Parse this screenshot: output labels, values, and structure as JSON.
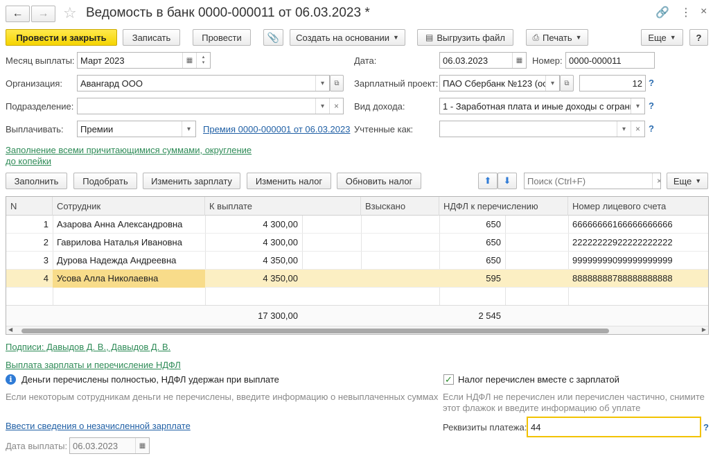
{
  "title": "Ведомость в банк 0000-000011 от 06.03.2023 *",
  "toolbar": {
    "post_close": "Провести и закрыть",
    "save": "Записать",
    "post": "Провести",
    "create_based": "Создать на основании",
    "export_file": "Выгрузить файл",
    "print": "Печать",
    "more": "Еще",
    "help": "?"
  },
  "form": {
    "month_label": "Месяц выплаты:",
    "month_value": "Март 2023",
    "date_label": "Дата:",
    "date_value": "06.03.2023",
    "number_label": "Номер:",
    "number_value": "0000-000011",
    "org_label": "Организация:",
    "org_value": "Авангард ООО",
    "project_label": "Зарплатный проект:",
    "project_value": "ПАО Сбербанк №123 (ос",
    "project_count": "12",
    "dept_label": "Подразделение:",
    "dept_value": "",
    "income_label": "Вид дохода:",
    "income_value": "1 - Заработная плата и иные доходы с ограни",
    "pay_label": "Выплачивать:",
    "pay_value": "Премии",
    "pay_link": "Премия 0000-000001 от 06.03.2023",
    "counted_label": "Учтенные как:",
    "counted_value": "",
    "fill_link_1": "Заполнение всеми причитающимися суммами, округление",
    "fill_link_2": "до копейки"
  },
  "table_toolbar": {
    "fill": "Заполнить",
    "pick": "Подобрать",
    "change_salary": "Изменить зарплату",
    "change_tax": "Изменить налог",
    "update_tax": "Обновить налог",
    "search_placeholder": "Поиск (Ctrl+F)",
    "more": "Еще"
  },
  "table": {
    "columns": [
      "N",
      "Сотрудник",
      "К выплате",
      "Взыскано",
      "НДФЛ к перечислению",
      "Номер лицевого счета"
    ],
    "rows": [
      {
        "n": "1",
        "employee": "Азарова Анна Александровна",
        "pay": "4 300,00",
        "recovered": "",
        "ndfl": "650",
        "account": "66666666166666666666"
      },
      {
        "n": "2",
        "employee": "Гаврилова Наталья Ивановна",
        "pay": "4 300,00",
        "recovered": "",
        "ndfl": "650",
        "account": "22222222922222222222"
      },
      {
        "n": "3",
        "employee": "Дурова Надежда Андреевна",
        "pay": "4 350,00",
        "recovered": "",
        "ndfl": "650",
        "account": "99999999099999999999"
      },
      {
        "n": "4",
        "employee": "Усова Алла Николаевна",
        "pay": "4 350,00",
        "recovered": "",
        "ndfl": "595",
        "account": "88888888788888888888"
      }
    ],
    "total_pay": "17 300,00",
    "total_ndfl": "2 545"
  },
  "bottom": {
    "signatures_link": "Подписи: Давыдов Д. В., Давыдов Д. В.",
    "payout_link": "Выплата зарплаты и перечисление НДФЛ",
    "info_text": "Деньги перечислены  полностью, НДФЛ удержан при выплате",
    "info_note": "Если некоторым сотрудникам деньги не перечислены, введите информацию о невыплаченных суммах",
    "unpaid_link": "Ввести сведения о незачисленной зарплате",
    "paydate_label": "Дата выплаты:",
    "paydate_value": "06.03.2023",
    "tax_checkbox_label": "Налог перечислен вместе с зарплатой",
    "tax_checked": true,
    "tax_note_1": "Если НДФЛ не перечислен или перечислен частично, снимите",
    "tax_note_2": "этот флажок и введите информацию об уплате",
    "payment_details_label": "Реквизиты платежа:",
    "payment_details_value": "44"
  }
}
